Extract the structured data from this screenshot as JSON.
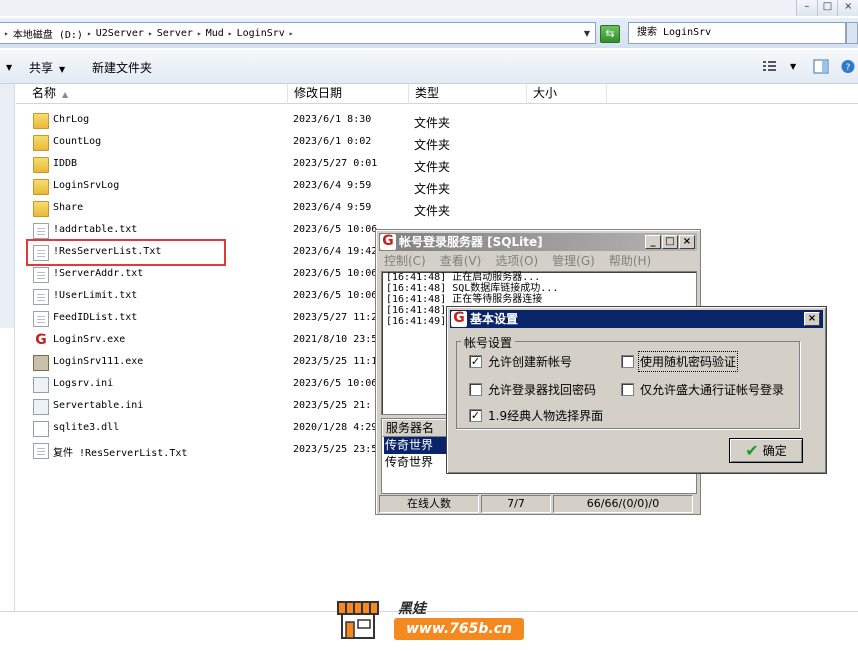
{
  "address": {
    "crumbs": [
      "本地磁盘 (D:)",
      "U2Server",
      "Server",
      "Mud",
      "LoginSrv"
    ],
    "search_placeholder": "搜索 LoginSrv"
  },
  "toolbar": {
    "share": "共享",
    "new_folder": "新建文件夹"
  },
  "columns": {
    "name": "名称",
    "date": "修改日期",
    "type": "类型",
    "size": "大小"
  },
  "files": [
    {
      "name": "ChrLog",
      "date": "2023/6/1 8:30",
      "type": "文件夹",
      "icon": "folder-icon"
    },
    {
      "name": "CountLog",
      "date": "2023/6/1 0:02",
      "type": "文件夹",
      "icon": "folder-icon"
    },
    {
      "name": "IDDB",
      "date": "2023/5/27 0:01",
      "type": "文件夹",
      "icon": "folder-icon"
    },
    {
      "name": "LoginSrvLog",
      "date": "2023/6/4 9:59",
      "type": "文件夹",
      "icon": "folder-icon"
    },
    {
      "name": "Share",
      "date": "2023/6/4 9:59",
      "type": "文件夹",
      "icon": "folder-icon"
    },
    {
      "name": "!addrtable.txt",
      "date": "2023/6/5 10:06",
      "type": "",
      "icon": "text-file-icon"
    },
    {
      "name": "!ResServerList.Txt",
      "date": "2023/6/4 19:42",
      "type": "",
      "icon": "text-file-icon"
    },
    {
      "name": "!ServerAddr.txt",
      "date": "2023/6/5 10:06",
      "type": "",
      "icon": "text-file-icon"
    },
    {
      "name": "!UserLimit.txt",
      "date": "2023/6/5 10:06",
      "type": "",
      "icon": "text-file-icon"
    },
    {
      "name": "FeedIDList.txt",
      "date": "2023/5/27 11:2",
      "type": "",
      "icon": "text-file-icon"
    },
    {
      "name": "LoginSrv.exe",
      "date": "2021/8/10 23:5",
      "type": "",
      "icon": "app-g-icon"
    },
    {
      "name": "LoginSrv111.exe",
      "date": "2023/5/25 11:1",
      "type": "",
      "icon": "game-exe-icon"
    },
    {
      "name": "Logsrv.ini",
      "date": "2023/6/5 10:06",
      "type": "",
      "icon": "settings-file-icon"
    },
    {
      "name": "Servertable.ini",
      "date": "2023/5/25 21:",
      "type": "",
      "icon": "settings-file-icon"
    },
    {
      "name": "sqlite3.dll",
      "date": "2020/1/28 4:29",
      "type": "",
      "icon": "dll-file-icon"
    },
    {
      "name": "复件 !ResServerList.Txt",
      "date": "2023/5/25 23:5",
      "type": "",
      "icon": "text-file-icon"
    }
  ],
  "login_window": {
    "title": "帐号登录服务器 [SQLite]",
    "menu": [
      "控制(C)",
      "查看(V)",
      "选项(O)",
      "管理(G)",
      "帮助(H)"
    ],
    "log": [
      "[16:41:48] 正在启动服务器...",
      "[16:41:48] SQL数据库链接成功...",
      "[16:41:48] 正在等待服务器连接",
      "[16:41:48]",
      "[16:41:49]"
    ],
    "list_header": "服务器名",
    "servers": [
      "传奇世界",
      "传奇世界"
    ],
    "status": [
      "在线人数",
      "7/7",
      "66/66/(0/0)/0"
    ]
  },
  "settings_dialog": {
    "title": "基本设置",
    "group": "帐号设置",
    "options": [
      {
        "label": "允许创建新帐号",
        "checked": true
      },
      {
        "label": "使用随机密码验证",
        "checked": false
      },
      {
        "label": "允许登录器找回密码",
        "checked": false
      },
      {
        "label": "仅允许盛大通行证帐号登录",
        "checked": false
      },
      {
        "label": "1.9经典人物选择界面",
        "checked": true
      }
    ],
    "ok": "确定"
  },
  "watermark": {
    "name": "黑娃",
    "url": "www.765b.cn"
  }
}
